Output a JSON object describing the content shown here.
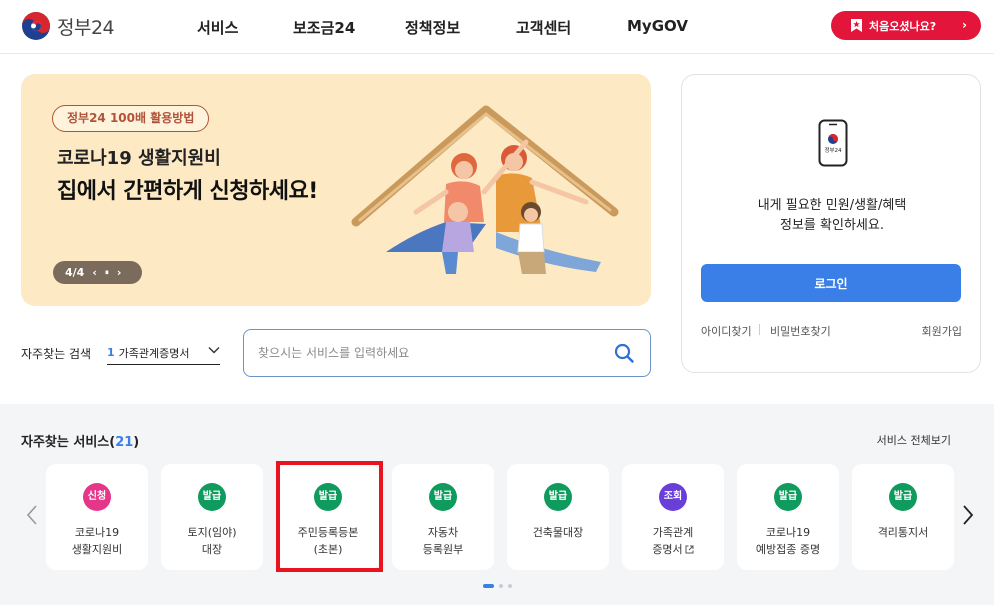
{
  "header": {
    "logo_text": "정부24",
    "nav": [
      "서비스",
      "보조금24",
      "정책정보",
      "고객센터",
      "MyGOV"
    ],
    "cta_label": "처음오셨나요?",
    "cta_chevron": "›"
  },
  "banner": {
    "tag": "정부24 100배 활용방법",
    "line1": "코로나19 생활지원비",
    "line2": "집에서 간편하게 신청하세요!",
    "pager": {
      "counter": "4/4",
      "prev": "‹",
      "pause": "⏸",
      "next": "›"
    }
  },
  "login": {
    "phone_label": "정부24",
    "message_line1": "내게 필요한 민원/생활/혜택",
    "message_line2": "정보를 확인하세요.",
    "button": "로그인",
    "find_id": "아이디찾기",
    "find_pw": "비밀번호찾기",
    "signup": "회원가입"
  },
  "frequent_search": {
    "label": "자주찾는 검색",
    "selected_num": "1",
    "selected_text": "가족관계증명서"
  },
  "search": {
    "placeholder": "찾으시는 서비스를 입력하세요"
  },
  "services": {
    "title": "자주찾는 서비스",
    "count": "21",
    "view_all": "서비스 전체보기",
    "items": [
      {
        "badge": "신청",
        "badge_color": "#e6368a",
        "line1": "코로나19",
        "line2": "생활지원비"
      },
      {
        "badge": "발급",
        "badge_color": "#0f9b5d",
        "line1": "토지(임야)",
        "line2": "대장"
      },
      {
        "badge": "발급",
        "badge_color": "#0f9b5d",
        "line1": "주민등록등본",
        "line2": "(초본)"
      },
      {
        "badge": "발급",
        "badge_color": "#0f9b5d",
        "line1": "자동차",
        "line2": "등록원부"
      },
      {
        "badge": "발급",
        "badge_color": "#0f9b5d",
        "line1": "건축물대장",
        "line2": ""
      },
      {
        "badge": "조회",
        "badge_color": "#6a3fd9",
        "line1": "가족관계",
        "line2": "증명서"
      },
      {
        "badge": "발급",
        "badge_color": "#0f9b5d",
        "line1": "코로나19",
        "line2": "예방접종 증명"
      },
      {
        "badge": "발급",
        "badge_color": "#0f9b5d",
        "line1": "격리통지서",
        "line2": ""
      }
    ]
  },
  "colors": {
    "accent": "#3a7ee8",
    "brand_red": "#e3153a",
    "highlight": "#e8141f",
    "banner_bg": "#fde9c4"
  }
}
